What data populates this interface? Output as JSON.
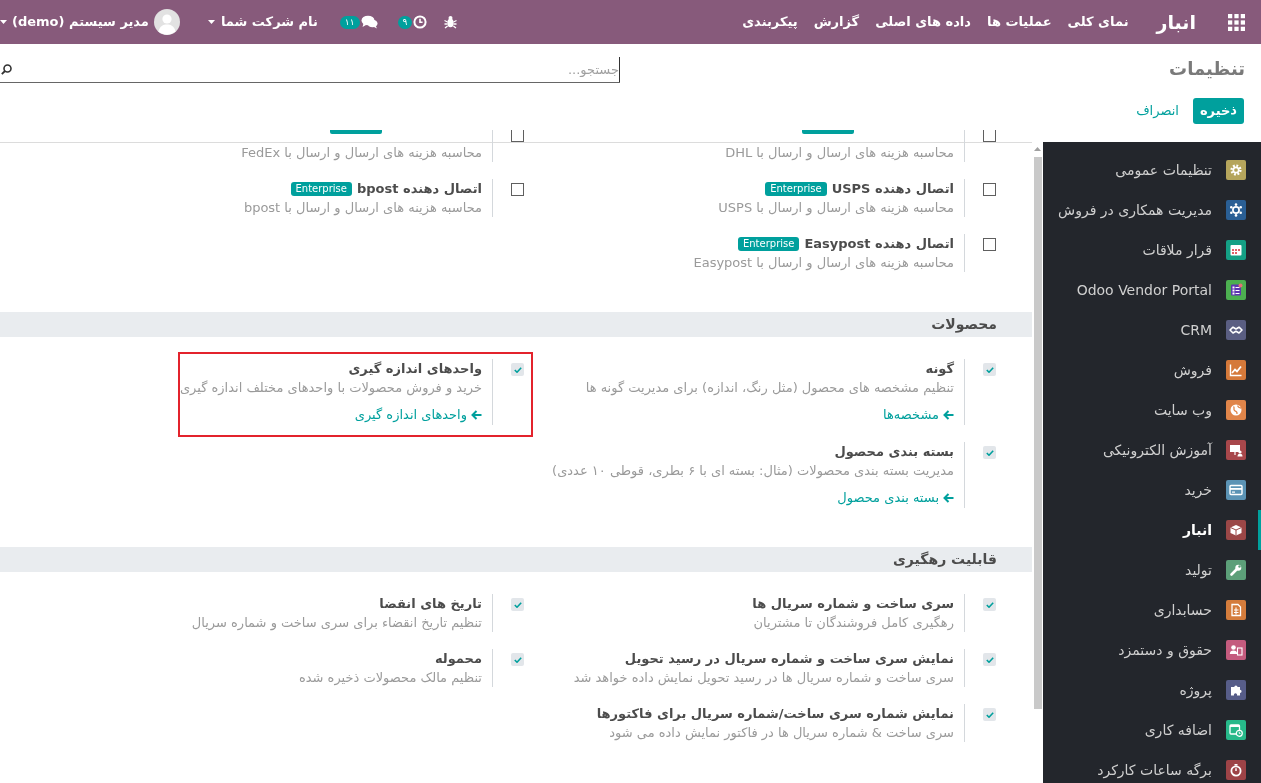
{
  "navbar": {
    "brand": "انبار",
    "menu": [
      "نمای کلی",
      "عملیات ها",
      "داده های اصلی",
      "گزارش",
      "پیکربندی"
    ],
    "activity_count": "۹",
    "message_count": "۱۱",
    "company": "نام شرکت شما",
    "user": "مدیر سیستم (demo)"
  },
  "control_panel": {
    "title": "تنظیمات",
    "search": {
      "placeholder": "جستجو..."
    },
    "buttons": [
      {
        "label": "ذخیره",
        "kind": "primary"
      },
      {
        "label": "انصراف",
        "kind": "link"
      }
    ]
  },
  "settings": {
    "sections": [
      {
        "items": [
          {
            "kind": "clipped",
            "badge_edge": true,
            "description": "محاسبه هزینه های ارسال و ارسال با DHL",
            "checked": false,
            "highlighted": false
          },
          {
            "kind": "clipped",
            "badge_edge": true,
            "description": "محاسبه هزینه های ارسال و ارسال با FedEx",
            "checked": false,
            "highlighted": false
          },
          {
            "kind": "setting",
            "title": "اتصال دهنده USPS",
            "badge": "Enterprise",
            "description": "محاسبه هزینه های ارسال و ارسال با USPS",
            "checked": false,
            "highlighted": false
          },
          {
            "kind": "setting",
            "title": "اتصال دهنده bpost",
            "badge": "Enterprise",
            "description": "محاسبه هزینه های ارسال و ارسال با bpost",
            "checked": false,
            "highlighted": false
          },
          {
            "kind": "setting",
            "title": "اتصال دهنده Easypost",
            "badge": "Enterprise",
            "description": "محاسبه هزینه های ارسال و ارسال با Easypost",
            "checked": false,
            "highlighted": false
          }
        ]
      },
      {
        "title": "محصولات",
        "items": [
          {
            "kind": "setting",
            "title": "گونه",
            "description": "تنظیم مشخصه های محصول (مثل رنگ، اندازه) برای مدیریت گونه ها",
            "link": "مشخصه‌ها",
            "checked": true,
            "highlighted": false
          },
          {
            "kind": "setting",
            "title": "واحدهای اندازه گیری",
            "description": "خرید و فروش محصولات با واحدهای مختلف اندازه گیری",
            "link": "واحدهای اندازه گیری",
            "checked": true,
            "highlighted": true
          },
          {
            "kind": "setting",
            "title": "بسته بندی محصول",
            "description": "مدیریت بسته بندی محصولات (مثال: بسته ای با ۶ بطری، قوطی ۱۰ عددی)",
            "link": "بسته بندی محصول",
            "checked": true,
            "highlighted": false
          }
        ]
      },
      {
        "title": "قابلیت رهگیری",
        "items": [
          {
            "kind": "setting",
            "title": "سری ساخت و شماره سریال ها",
            "description": "رهگیری کامل فروشندگان تا مشتریان",
            "checked": true,
            "highlighted": false
          },
          {
            "kind": "setting",
            "title": "تاریخ های انقضا",
            "description": "تنظیم تاریخ انقضاء برای سری ساخت و شماره سریال",
            "checked": true,
            "highlighted": false
          },
          {
            "kind": "setting",
            "title": "نمایش سری ساخت و شماره سریال در رسید تحویل",
            "description": "سری ساخت و شماره سریال ها در رسید تحویل نمایش داده خواهد شد",
            "checked": true,
            "highlighted": false
          },
          {
            "kind": "setting",
            "title": "محموله",
            "description": "تنظیم مالک محصولات ذخیره شده",
            "checked": true,
            "highlighted": false
          },
          {
            "kind": "setting",
            "title": "نمایش شماره سری ساخت/شماره سریال برای فاکتورها",
            "description": "سری ساخت & شماره سریال ها در فاکتور نمایش داده می شود",
            "checked": true,
            "highlighted": false
          }
        ]
      }
    ]
  },
  "sidebar": {
    "items": [
      {
        "label": "تنظیمات عمومی",
        "color": "#b5a55c",
        "selected": false
      },
      {
        "label": "مدیریت همکاری در فروش",
        "color": "#2a5f95",
        "selected": false
      },
      {
        "label": "قرار ملاقات",
        "color": "#14a085",
        "selected": false
      },
      {
        "label": "Odoo Vendor Portal",
        "color": "#4caf50",
        "selected": false
      },
      {
        "label": "CRM",
        "color": "#5a5e82",
        "selected": false
      },
      {
        "label": "فروش",
        "color": "#d5793a",
        "selected": false
      },
      {
        "label": "وب سایت",
        "color": "#e0854a",
        "selected": false
      },
      {
        "label": "آموزش الکترونیکی",
        "color": "#a8474b",
        "selected": false
      },
      {
        "label": "خرید",
        "color": "#5b93b5",
        "selected": false
      },
      {
        "label": "انبار",
        "color": "#9b4747",
        "selected": true
      },
      {
        "label": "تولید",
        "color": "#5c9f79",
        "selected": false
      },
      {
        "label": "حسابداری",
        "color": "#d47c3c",
        "selected": false
      },
      {
        "label": "حقوق و دستمزد",
        "color": "#c45b7e",
        "selected": false
      },
      {
        "label": "پروژه",
        "color": "#575d89",
        "selected": false
      },
      {
        "label": "اضافه کاری",
        "color": "#27b98a",
        "selected": false
      },
      {
        "label": "برگه ساعات کارکرد",
        "color": "#9d4347",
        "selected": false
      }
    ]
  }
}
